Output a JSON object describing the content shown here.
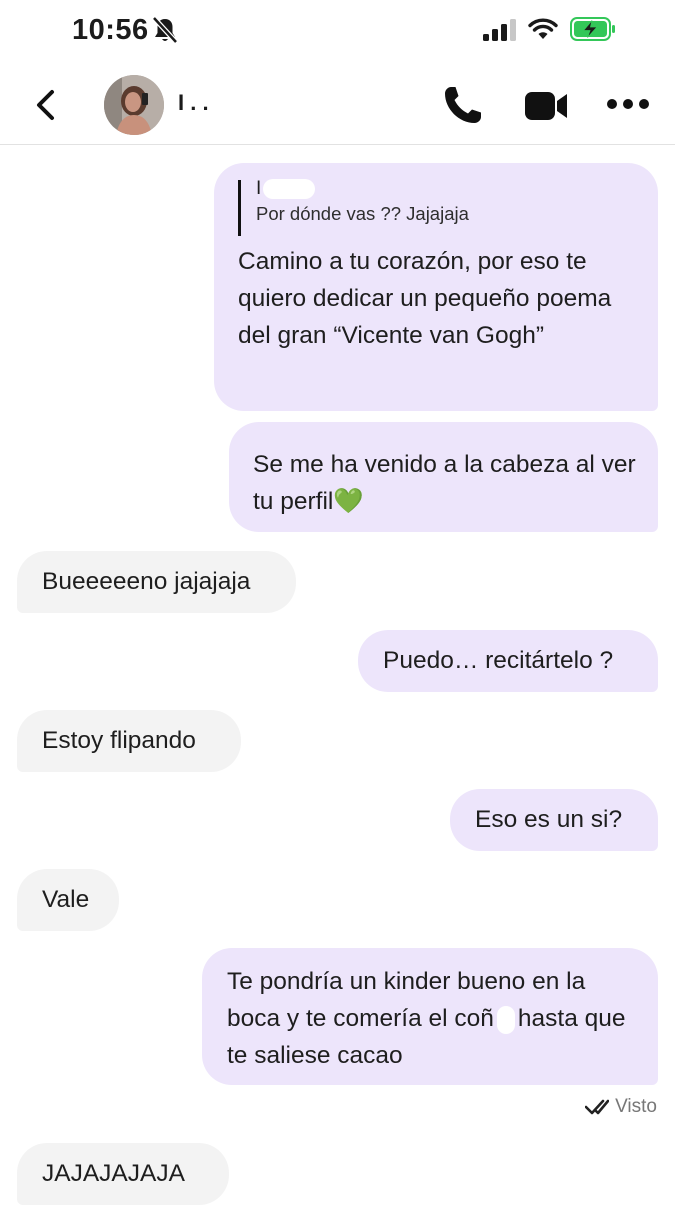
{
  "status_bar": {
    "time": "10:56",
    "icons": [
      "bell-muted-icon",
      "cellular-signal-icon",
      "wifi-icon",
      "battery-charging-icon"
    ],
    "battery_color": "#34c759"
  },
  "header": {
    "contact_name": "I  .  .",
    "icons": [
      "back-arrow-icon",
      "phone-call-icon",
      "video-call-icon",
      "more-options-icon"
    ]
  },
  "colors": {
    "outgoing_bubble": "#ede5fb",
    "incoming_bubble": "#f3f3f3"
  },
  "messages": [
    {
      "direction": "out",
      "reply_author": "I",
      "reply_text": "Por dónde vas ?? Jajajaja",
      "text": "Camino a tu corazón, por eso te quiero dedicar un pequeño poema del gran “Vicente van Gogh”"
    },
    {
      "direction": "out",
      "text": "Se me ha venido a la cabeza al ver tu perfil💚"
    },
    {
      "direction": "in",
      "text": "Bueeeeeno jajajaja"
    },
    {
      "direction": "out",
      "text": "Puedo… recitártelo ?"
    },
    {
      "direction": "in",
      "text": "Estoy flipando"
    },
    {
      "direction": "out",
      "text": "Eso es un si?"
    },
    {
      "direction": "in",
      "text": "Vale"
    },
    {
      "direction": "out",
      "text_part1": "Te pondría un kinder bueno en la boca y te comería el coñ",
      "text_part2": "hasta que te saliese cacao"
    },
    {
      "direction": "in",
      "text": "JAJAJAJAJA"
    }
  ],
  "read_receipt": {
    "label": "Visto",
    "icon": "double-check-icon"
  }
}
